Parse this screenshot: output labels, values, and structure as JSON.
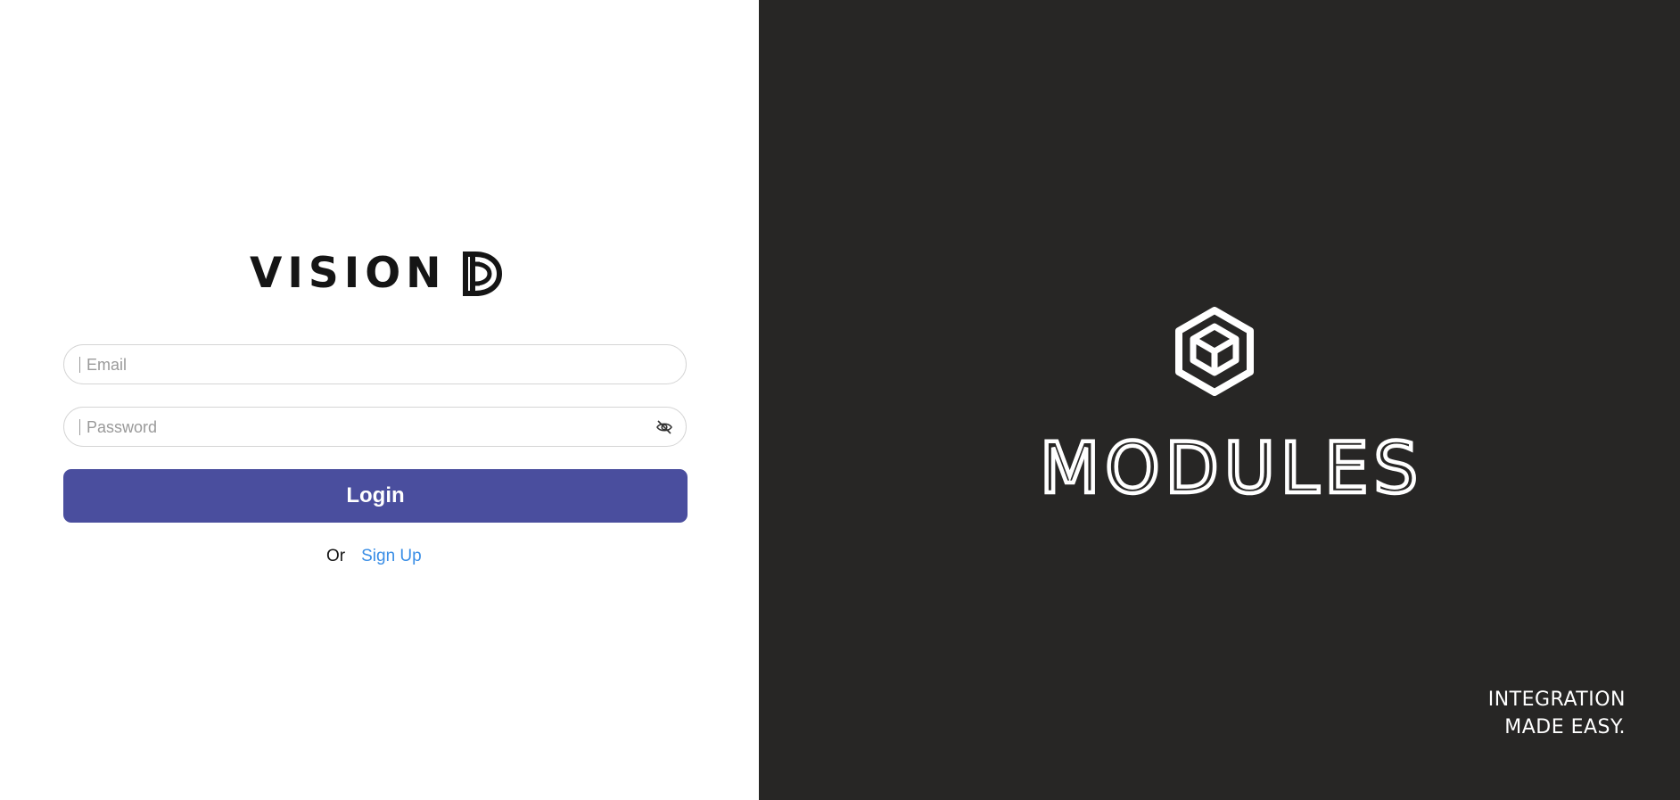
{
  "login_panel": {
    "brand_name": "VISION",
    "brand_mark_icon": "vision-d-mark-icon",
    "email": {
      "placeholder": "Email",
      "value": ""
    },
    "password": {
      "placeholder": "Password",
      "value": "",
      "toggle_icon": "eye-slash-icon"
    },
    "login_label": "Login",
    "or_text": "Or",
    "signup_label": "Sign Up"
  },
  "brand_panel": {
    "logo_icon": "cube-icon",
    "product_name": "MODULES",
    "tagline_line1": "INTEGRATION",
    "tagline_line2": "MADE EASY."
  },
  "colors": {
    "left_background": "#ffffff",
    "right_background": "#272625",
    "button_background": "#4a4e9e",
    "link_color": "#3a8ee6",
    "input_border": "#d5d5d5"
  }
}
